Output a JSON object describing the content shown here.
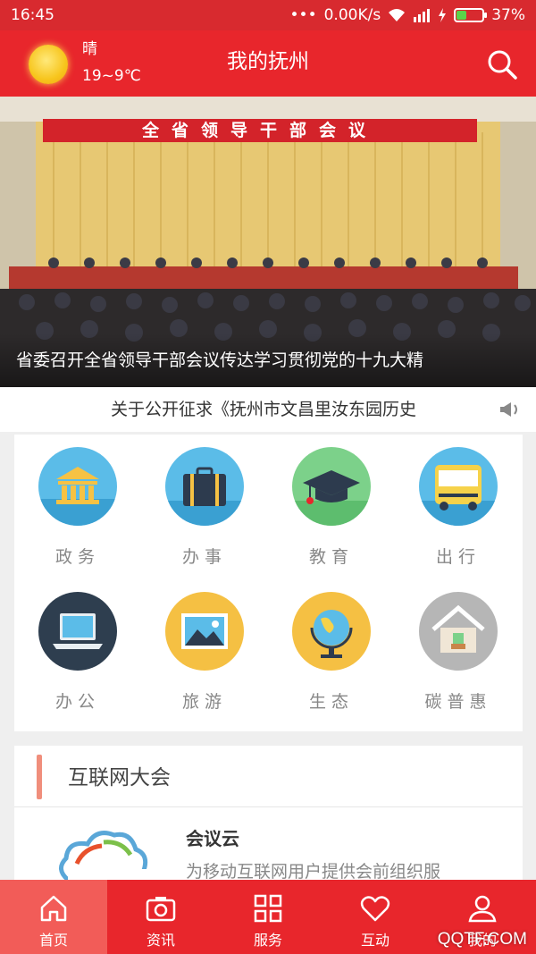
{
  "status_bar": {
    "time": "16:45",
    "network": "0.00K/s",
    "battery_percent": "37%",
    "battery_level": 0.37
  },
  "header": {
    "weather_condition": "晴",
    "temperature": "19~9℃",
    "title": "我的抚州"
  },
  "banner": {
    "slogan": "全省领导干部会议",
    "caption": "省委召开全省领导干部会议传达学习贯彻党的十九大精"
  },
  "notice": {
    "text": "关于公开征求《抚州市文昌里汝东园历史"
  },
  "categories": [
    {
      "label": "政务",
      "icon": "government-building-icon",
      "color": "#5bbce8"
    },
    {
      "label": "办事",
      "icon": "briefcase-icon",
      "color": "#5bbce8"
    },
    {
      "label": "教育",
      "icon": "graduation-cap-icon",
      "color": "#7cd18a"
    },
    {
      "label": "出行",
      "icon": "bus-icon",
      "color": "#5bbce8"
    },
    {
      "label": "办公",
      "icon": "laptop-icon",
      "color": "#2e3e4f"
    },
    {
      "label": "旅游",
      "icon": "picture-icon",
      "color": "#f5c043"
    },
    {
      "label": "生态",
      "icon": "globe-icon",
      "color": "#f5c043"
    },
    {
      "label": "碳普惠",
      "icon": "house-icon",
      "color": "#b6b6b6"
    }
  ],
  "section": {
    "title": "互联网大会",
    "item_title": "会议云",
    "item_desc": "为移动互联网用户提供会前组织服"
  },
  "tabs": [
    {
      "label": "首页",
      "icon": "home-icon",
      "active": true
    },
    {
      "label": "资讯",
      "icon": "camera-icon",
      "active": false
    },
    {
      "label": "服务",
      "icon": "grid-icon",
      "active": false
    },
    {
      "label": "互动",
      "icon": "heart-icon",
      "active": false
    },
    {
      "label": "我的",
      "icon": "user-icon",
      "active": false
    }
  ],
  "watermark": "QQTF.COM"
}
